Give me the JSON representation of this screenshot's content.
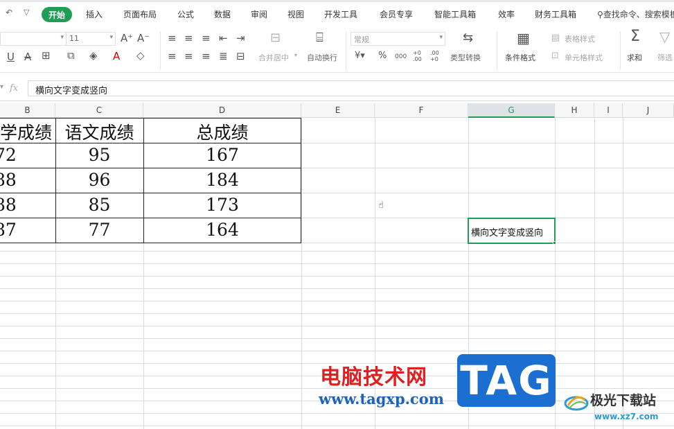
{
  "menu": {
    "items": [
      "开始",
      "插入",
      "页面布局",
      "公式",
      "数据",
      "审阅",
      "视图",
      "开发工具",
      "会员专享",
      "智能工具箱",
      "效率",
      "财务工具箱"
    ],
    "search_label": "查找命令、搜索模板"
  },
  "ribbon": {
    "font_size": "11",
    "number_format": "常规",
    "merge_center": "合并居中",
    "auto_wrap": "自动换行",
    "type_convert": "类型转换",
    "cond_format": "条件格式",
    "table_style": "表格样式",
    "cell_style": "单元格样式",
    "sum": "求和",
    "filter": "筛选",
    "percent": "%",
    "thousands": "000",
    "dec_increase": "+0 .00",
    "dec_decrease": ".00 +0",
    "currency": "¥"
  },
  "formula_bar": {
    "fx_label": "fx",
    "content": "横向文字变成竖向"
  },
  "grid": {
    "columns": [
      "B",
      "C",
      "D",
      "E",
      "F",
      "G",
      "H",
      "I",
      "J"
    ],
    "selected_column": "G"
  },
  "table": {
    "headers": [
      "学成绩",
      "语文成绩",
      "总成绩"
    ],
    "rows": [
      [
        "72",
        "95",
        "167"
      ],
      [
        "88",
        "96",
        "184"
      ],
      [
        "88",
        "85",
        "173"
      ],
      [
        "87",
        "77",
        "164"
      ]
    ]
  },
  "active_cell": {
    "value": "横向文字变成竖向"
  },
  "watermark": {
    "cn": "电脑技术网",
    "url": "www.tagxp.com",
    "tag": "TAG",
    "site": "极光下载站",
    "site_url": "www.xz7.com"
  }
}
